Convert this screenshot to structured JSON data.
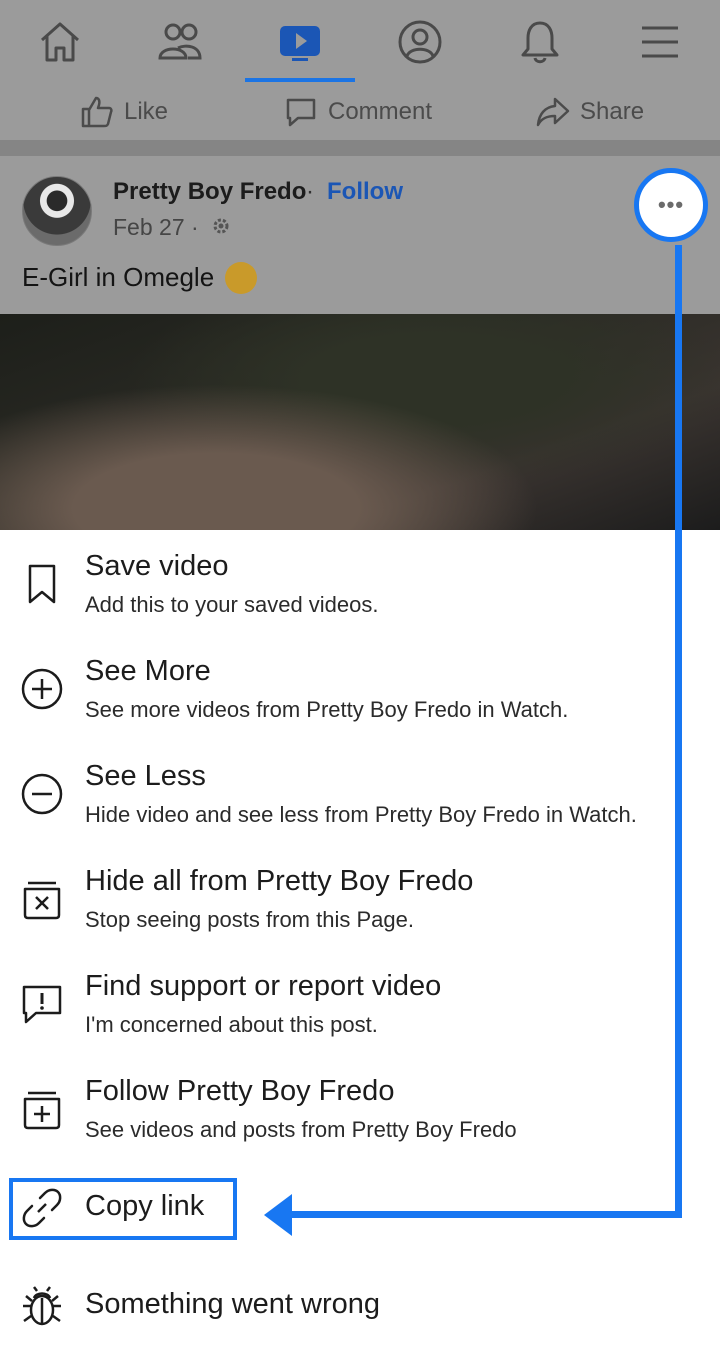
{
  "nav": {
    "icons": [
      "home-icon",
      "friends-icon",
      "watch-icon",
      "profile-icon",
      "notifications-icon",
      "menu-icon"
    ],
    "active": "watch-icon"
  },
  "actions": {
    "like": "Like",
    "comment": "Comment",
    "share": "Share"
  },
  "post": {
    "author": "Pretty Boy Fredo",
    "separator": "·",
    "follow": "Follow",
    "date": "Feb 27 ·",
    "caption": "E-Girl in Omegle"
  },
  "more_button": {
    "label": "•••"
  },
  "menu": {
    "items": [
      {
        "icon": "bookmark-icon",
        "title": "Save video",
        "subtitle": "Add this to your saved videos."
      },
      {
        "icon": "plus-circle-icon",
        "title": "See More",
        "subtitle": "See more videos from Pretty Boy Fredo in Watch."
      },
      {
        "icon": "minus-circle-icon",
        "title": "See Less",
        "subtitle": "Hide video and see less from Pretty Boy Fredo in Watch."
      },
      {
        "icon": "hide-all-icon",
        "title": "Hide all from Pretty Boy Fredo",
        "subtitle": "Stop seeing posts from this Page."
      },
      {
        "icon": "report-icon",
        "title": "Find support or report video",
        "subtitle": "I'm concerned about this post."
      },
      {
        "icon": "follow-icon",
        "title": "Follow Pretty Boy Fredo",
        "subtitle": "See videos and posts from Pretty Boy Fredo"
      },
      {
        "icon": "link-icon",
        "title": "Copy link"
      },
      {
        "icon": "bug-icon",
        "title": "Something went wrong"
      }
    ]
  },
  "colors": {
    "accent": "#1877f2",
    "overlay": "#9b9b9b",
    "follow": "#1b56b5"
  }
}
